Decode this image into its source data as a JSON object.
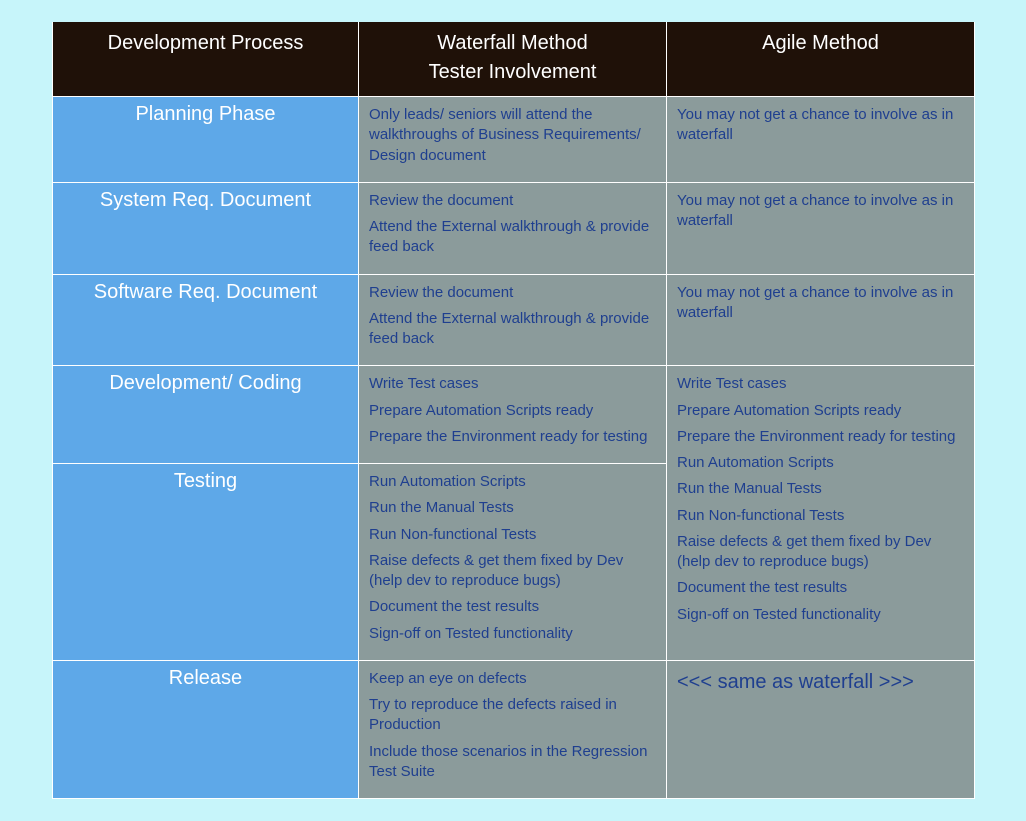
{
  "header": {
    "col1": "Development Process",
    "col2_line1": "Waterfall Method",
    "col2_line2": "Tester Involvement",
    "col3": "Agile Method"
  },
  "rows": {
    "planning": {
      "phase": "Planning Phase",
      "waterfall_1": "Only leads/ seniors will attend the walkthroughs of Business Requirements/ Design document",
      "agile_1": "You may not get a chance to involve as in waterfall"
    },
    "sysreq": {
      "phase": "System Req. Document",
      "waterfall_1": "Review the document",
      "waterfall_2": "Attend the External walkthrough & provide feed back",
      "agile_1": "You may not get a chance to involve as in waterfall"
    },
    "swreq": {
      "phase": "Software Req. Document",
      "waterfall_1": "Review the document",
      "waterfall_2": "Attend the External walkthrough & provide feed back",
      "agile_1": "You may not get a chance to involve as in waterfall"
    },
    "dev": {
      "phase": "Development/ Coding",
      "waterfall_1": "Write Test cases",
      "waterfall_2": "Prepare Automation Scripts ready",
      "waterfall_3": "Prepare the Environment ready for testing"
    },
    "testing": {
      "phase": "Testing",
      "waterfall_1": "Run Automation Scripts",
      "waterfall_2": "Run the Manual Tests",
      "waterfall_3": "Run Non-functional Tests",
      "waterfall_4": "Raise defects & get them fixed by Dev (help dev to reproduce bugs)",
      "waterfall_5": "Document the test results",
      "waterfall_6": "Sign-off on Tested functionality"
    },
    "agile_merged": {
      "a1": "Write Test cases",
      "a2": "Prepare Automation Scripts ready",
      "a3": "Prepare the Environment ready for testing",
      "a4": "Run Automation Scripts",
      "a5": "Run the Manual Tests",
      "a6": "Run Non-functional Tests",
      "a7": "Raise defects & get them fixed by Dev (help dev to reproduce bugs)",
      "a8": "Document the test results",
      "a9": "Sign-off on Tested functionality"
    },
    "release": {
      "phase": "Release",
      "waterfall_1": "Keep an eye on defects",
      "waterfall_2": "Try to reproduce the defects raised in Production",
      "waterfall_3": "Include those scenarios in the Regression Test Suite",
      "agile_1": "<<< same as waterfall >>>"
    }
  },
  "chart_data": {
    "type": "table",
    "title": "Tester Involvement — Waterfall vs Agile",
    "columns": [
      "Development Process",
      "Waterfall Method Tester Involvement",
      "Agile Method"
    ],
    "rows": [
      {
        "phase": "Planning Phase",
        "waterfall": [
          "Only leads/ seniors will attend the walkthroughs of Business Requirements/ Design document"
        ],
        "agile": [
          "You may not get a chance to involve as in waterfall"
        ]
      },
      {
        "phase": "System Req. Document",
        "waterfall": [
          "Review the document",
          "Attend the External walkthrough & provide feed back"
        ],
        "agile": [
          "You may not get a chance to involve as in waterfall"
        ]
      },
      {
        "phase": "Software Req. Document",
        "waterfall": [
          "Review the document",
          "Attend the External walkthrough & provide feed back"
        ],
        "agile": [
          "You may not get a chance to involve as in waterfall"
        ]
      },
      {
        "phase": "Development/ Coding",
        "waterfall": [
          "Write Test cases",
          "Prepare Automation Scripts ready",
          "Prepare the Environment ready for testing"
        ],
        "agile": [
          "Write Test cases",
          "Prepare Automation Scripts ready",
          "Prepare the Environment ready for testing",
          "Run Automation Scripts",
          "Run the Manual Tests",
          "Run Non-functional Tests",
          "Raise defects & get them fixed by Dev (help dev to reproduce bugs)",
          "Document the test results",
          "Sign-off on Tested functionality"
        ]
      },
      {
        "phase": "Testing",
        "waterfall": [
          "Run Automation Scripts",
          "Run the Manual Tests",
          "Run Non-functional Tests",
          "Raise defects & get them fixed by Dev (help dev to reproduce bugs)",
          "Document the test results",
          "Sign-off on Tested functionality"
        ],
        "agile": "merged with Development/ Coding above"
      },
      {
        "phase": "Release",
        "waterfall": [
          "Keep an eye on defects",
          "Try to reproduce the defects raised in Production",
          "Include those scenarios in the Regression Test Suite"
        ],
        "agile": [
          "<<< same as waterfall >>>"
        ]
      }
    ]
  }
}
